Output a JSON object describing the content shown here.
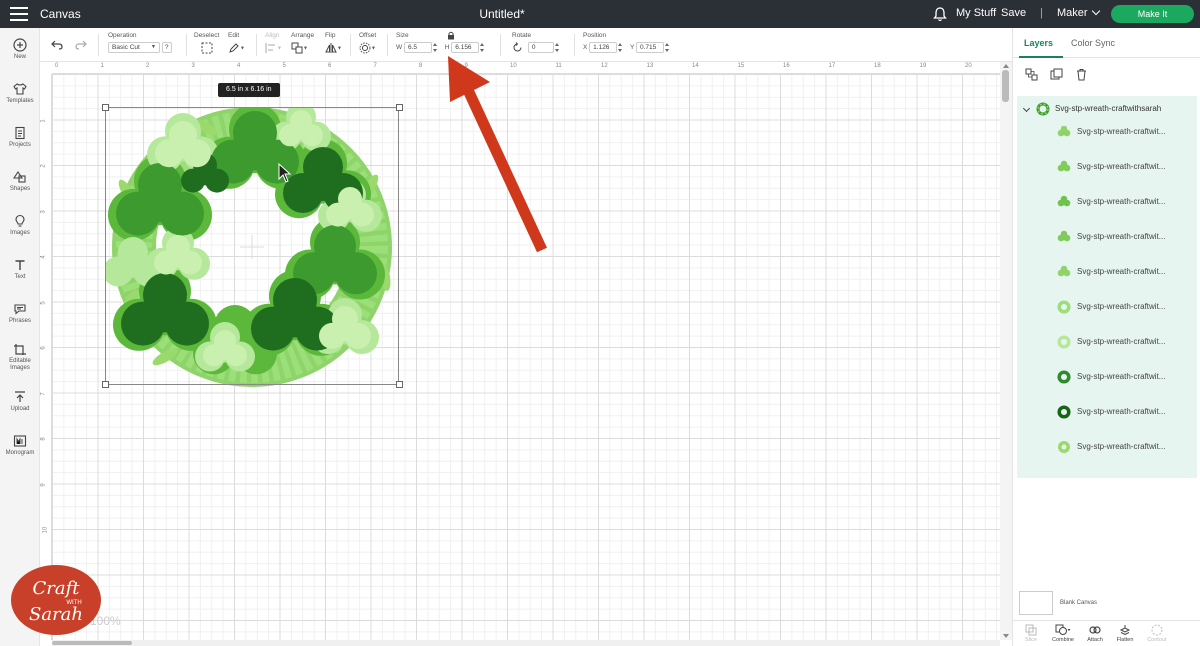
{
  "topbar": {
    "app_title": "Canvas",
    "doc_title": "Untitled*",
    "my_stuff": "My Stuff",
    "save": "Save",
    "separator": "|",
    "machine": "Maker",
    "make_it": "Make It"
  },
  "toolbar": {
    "operation_label": "Operation",
    "operation_value": "Basic Cut",
    "deselect_label": "Deselect",
    "edit_label": "Edit",
    "align_label": "Align",
    "arrange_label": "Arrange",
    "flip_label": "Flip",
    "offset_label": "Offset",
    "size_label": "Size",
    "width_prefix": "W",
    "width_value": "6.5",
    "height_prefix": "H",
    "height_value": "6.156",
    "rotate_label": "Rotate",
    "rotate_value": "0",
    "position_label": "Position",
    "x_prefix": "X",
    "x_value": "1.126",
    "y_prefix": "Y",
    "y_value": "0.715"
  },
  "sidebar": {
    "items": [
      {
        "label": "New",
        "icon": "plus-circle-icon"
      },
      {
        "label": "Templates",
        "icon": "shirt-icon"
      },
      {
        "label": "Projects",
        "icon": "projects-icon"
      },
      {
        "label": "Shapes",
        "icon": "shapes-icon"
      },
      {
        "label": "Images",
        "icon": "lightbulb-icon"
      },
      {
        "label": "Text",
        "icon": "text-icon"
      },
      {
        "label": "Phrases",
        "icon": "speech-bubble-icon"
      },
      {
        "label": "Editable Images",
        "icon": "editable-images-icon"
      },
      {
        "label": "Upload",
        "icon": "upload-icon"
      },
      {
        "label": "Monogram",
        "icon": "monogram-icon"
      }
    ]
  },
  "ruler": {
    "top": [
      "0",
      "1",
      "2",
      "3",
      "4",
      "5",
      "6",
      "7",
      "8",
      "9",
      "10",
      "11",
      "12",
      "13",
      "14",
      "15",
      "16",
      "17",
      "18",
      "19",
      "20"
    ],
    "left": [
      "1",
      "2",
      "3",
      "4",
      "5",
      "6",
      "7",
      "8",
      "9",
      "10"
    ]
  },
  "canvas": {
    "size_tooltip": "6.5  in x 6.16  in",
    "zoom_level": "100%"
  },
  "logo": {
    "line1": "Craft",
    "line2": "WITH",
    "line3": "Sarah"
  },
  "layers_panel": {
    "tabs": [
      {
        "label": "Layers",
        "active": true
      },
      {
        "label": "Color Sync",
        "active": false
      }
    ],
    "group_name": "Svg-stp-wreath-craftwithsarah",
    "layers": [
      {
        "name": "Svg-stp-wreath-craftwit...",
        "icon": "shamrock-light-icon",
        "color": "#8fd46a"
      },
      {
        "name": "Svg-stp-wreath-craftwit...",
        "icon": "shamrock-light-icon",
        "color": "#7fcc5a"
      },
      {
        "name": "Svg-stp-wreath-craftwit...",
        "icon": "shamrock-light-icon",
        "color": "#6fc24c"
      },
      {
        "name": "Svg-stp-wreath-craftwit...",
        "icon": "shamrock-light-icon",
        "color": "#7fcc5a"
      },
      {
        "name": "Svg-stp-wreath-craftwit...",
        "icon": "shamrock-light-icon",
        "color": "#8fd46a"
      },
      {
        "name": "Svg-stp-wreath-craftwit...",
        "icon": "wreath-ring-icon",
        "color": "#9adf78"
      },
      {
        "name": "Svg-stp-wreath-craftwit...",
        "icon": "wreath-ring-icon",
        "color": "#b5e89a"
      },
      {
        "name": "Svg-stp-wreath-craftwit...",
        "icon": "wreath-ring-icon",
        "color": "#2e8b2e"
      },
      {
        "name": "Svg-stp-wreath-craftwit...",
        "icon": "wreath-ring-icon",
        "color": "#166516"
      },
      {
        "name": "Svg-stp-wreath-craftwit...",
        "icon": "circle-icon",
        "color": "#9ad96c"
      }
    ],
    "blank_canvas_label": "Blank Canvas",
    "bottom_tools": [
      {
        "label": "Slice",
        "enabled": false
      },
      {
        "label": "Combine",
        "enabled": true
      },
      {
        "label": "Attach",
        "enabled": true
      },
      {
        "label": "Flatten",
        "enabled": true
      },
      {
        "label": "Contour",
        "enabled": false
      }
    ]
  },
  "colors": {
    "topbar_bg": "#2b2f36",
    "make_it_green": "#1aa95f",
    "accent_teal": "#1a7f63",
    "layers_group_bg": "#e6f5ef",
    "arrow_red": "#d0381c",
    "logo_red": "#c8402a"
  }
}
